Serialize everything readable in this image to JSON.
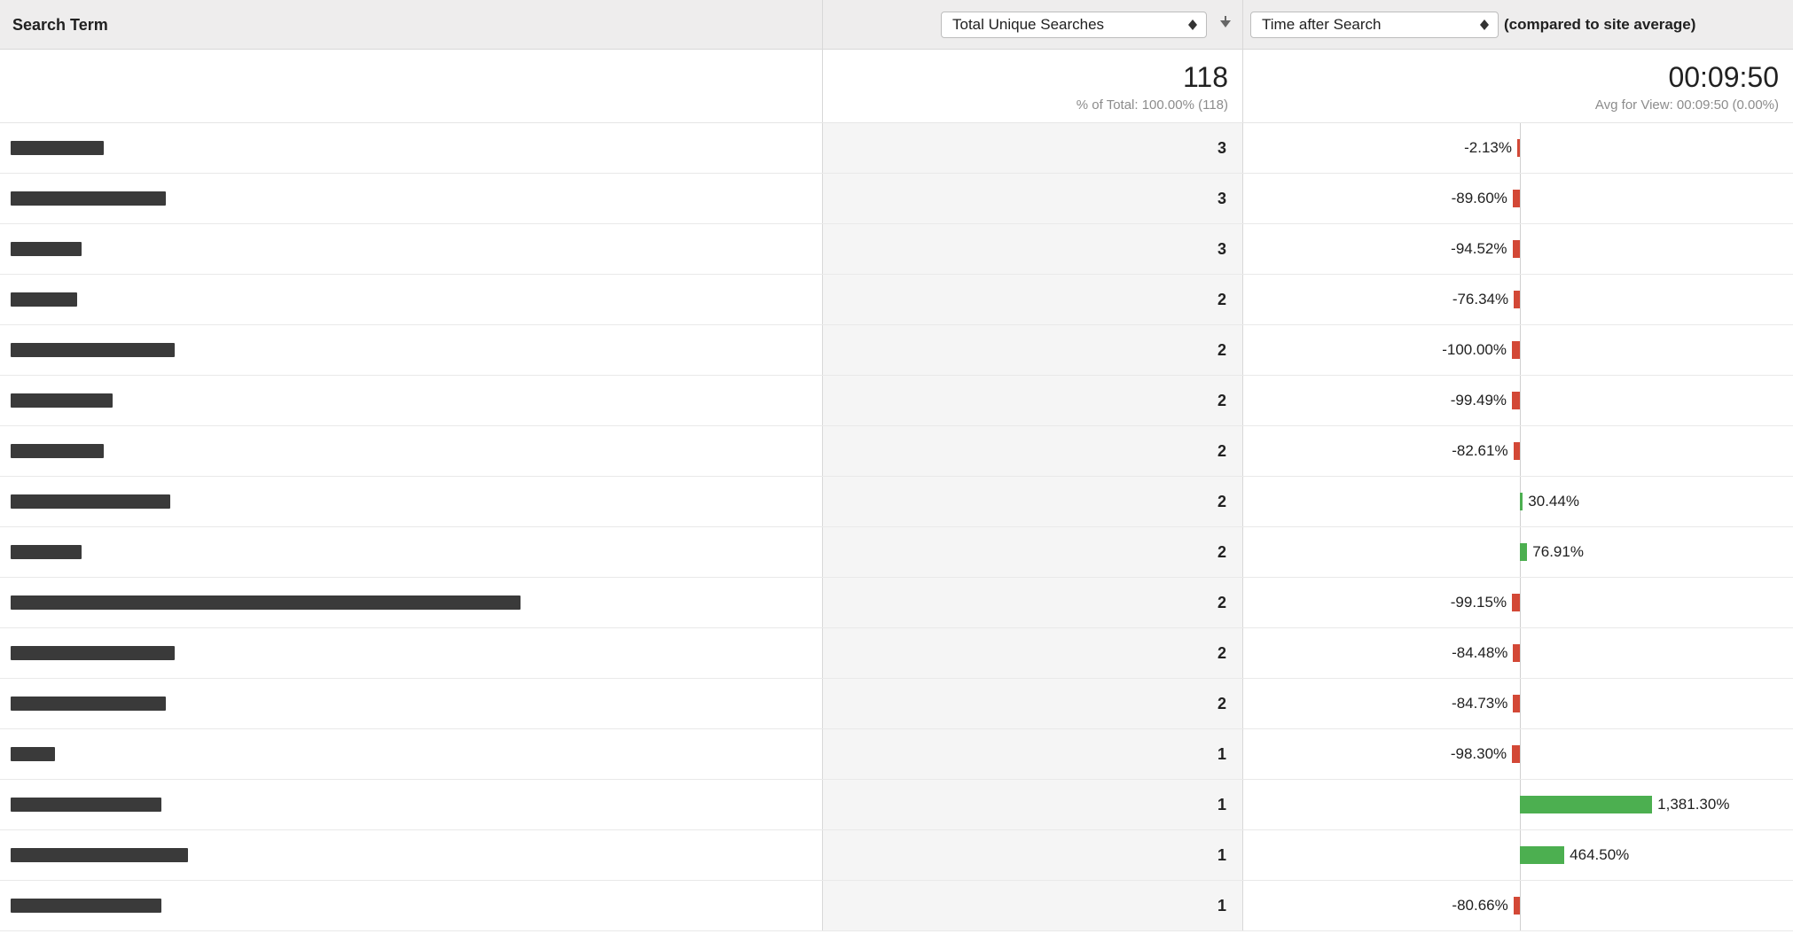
{
  "header": {
    "term_label": "Search Term",
    "metric_select": "Total Unique Searches",
    "compare_select": "Time after Search",
    "compare_note": "(compared to site average)"
  },
  "summary": {
    "metric_total": "118",
    "metric_sub": "% of Total: 100.00% (118)",
    "compare_total": "00:09:50",
    "compare_sub": "Avg for View: 00:09:50 (0.00%)"
  },
  "rows": [
    {
      "redact_w": 105,
      "count": "3",
      "pct": -2.13,
      "pct_label": "-2.13%"
    },
    {
      "redact_w": 175,
      "count": "3",
      "pct": -89.6,
      "pct_label": "-89.60%"
    },
    {
      "redact_w": 80,
      "count": "3",
      "pct": -94.52,
      "pct_label": "-94.52%"
    },
    {
      "redact_w": 75,
      "count": "2",
      "pct": -76.34,
      "pct_label": "-76.34%"
    },
    {
      "redact_w": 185,
      "count": "2",
      "pct": -100.0,
      "pct_label": "-100.00%"
    },
    {
      "redact_w": 115,
      "count": "2",
      "pct": -99.49,
      "pct_label": "-99.49%"
    },
    {
      "redact_w": 105,
      "count": "2",
      "pct": -82.61,
      "pct_label": "-82.61%"
    },
    {
      "redact_w": 180,
      "count": "2",
      "pct": 30.44,
      "pct_label": "30.44%"
    },
    {
      "redact_w": 80,
      "count": "2",
      "pct": 76.91,
      "pct_label": "76.91%"
    },
    {
      "redact_w": 575,
      "count": "2",
      "pct": -99.15,
      "pct_label": "-99.15%"
    },
    {
      "redact_w": 185,
      "count": "2",
      "pct": -84.48,
      "pct_label": "-84.48%"
    },
    {
      "redact_w": 175,
      "count": "2",
      "pct": -84.73,
      "pct_label": "-84.73%"
    },
    {
      "redact_w": 50,
      "count": "1",
      "pct": -98.3,
      "pct_label": "-98.30%"
    },
    {
      "redact_w": 170,
      "count": "1",
      "pct": 1381.3,
      "pct_label": "1,381.30%"
    },
    {
      "redact_w": 200,
      "count": "1",
      "pct": 464.5,
      "pct_label": "464.50%"
    },
    {
      "redact_w": 170,
      "count": "1",
      "pct": -80.66,
      "pct_label": "-80.66%"
    }
  ]
}
